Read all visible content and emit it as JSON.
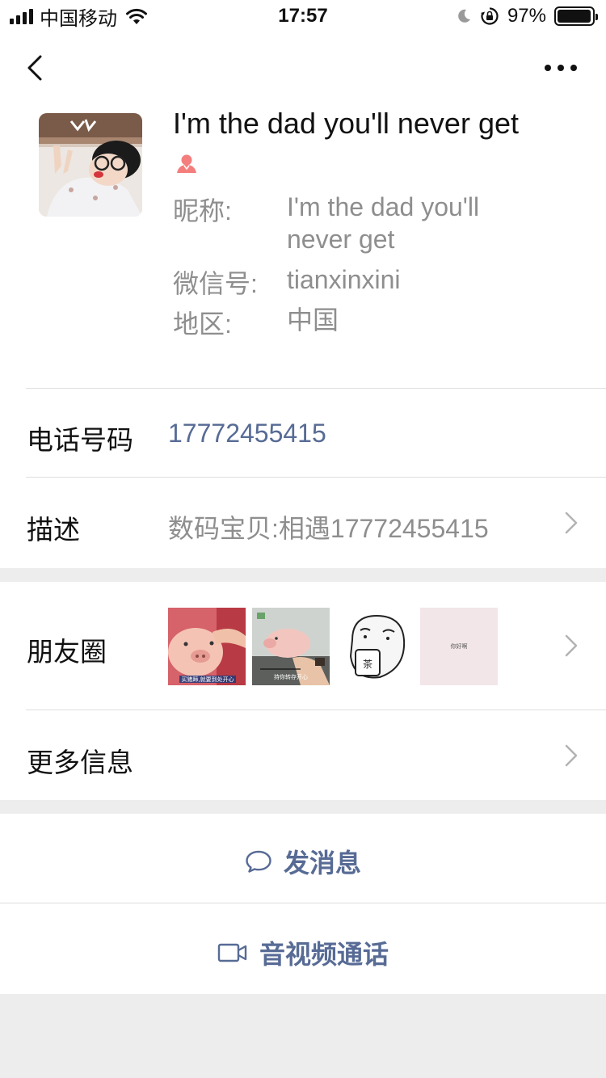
{
  "status_bar": {
    "carrier": "中国移动",
    "time": "17:57",
    "battery_percent": "97%",
    "battery_level": 0.97,
    "icons": [
      "signal-icon",
      "wifi-icon",
      "moon-icon",
      "rotation-lock-icon",
      "battery-icon"
    ]
  },
  "nav": {
    "back_icon": "chevron-left-icon",
    "more_icon": "more-icon"
  },
  "profile": {
    "name": "I'm the dad you'll never get",
    "gender_icon": "female-icon",
    "nickname_label": "昵称:",
    "nickname_value": "I'm the dad you'll never get",
    "wechat_id_label": "微信号:",
    "wechat_id_value": "tianxinxini",
    "region_label": "地区:",
    "region_value": "中国"
  },
  "details": {
    "phone_label": "电话号码",
    "phone_value": "17772455415",
    "description_label": "描述",
    "description_value": "数码宝贝:相遇17772455415"
  },
  "moments": {
    "label": "朋友圈",
    "thumbnails": [
      {
        "caption": "买猪蹄,就要到处开心"
      },
      {
        "caption": "持你转存开心"
      },
      {
        "caption": "茶"
      },
      {
        "caption": "你好啊"
      }
    ]
  },
  "more_info": {
    "label": "更多信息"
  },
  "actions": {
    "send_message": "发消息",
    "video_call": "音视频通话"
  },
  "colors": {
    "link": "#576b95",
    "secondary_text": "#8e8e8e",
    "background": "#ededed",
    "gender_female": "#f37e7d"
  }
}
